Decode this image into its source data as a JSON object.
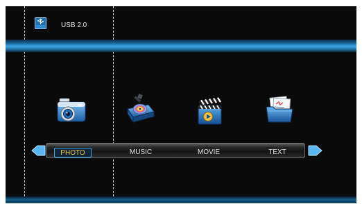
{
  "header": {
    "device_label": "USB 2.0",
    "device_icon": "usb-drive-icon"
  },
  "menu": {
    "items": [
      {
        "label": "PHOTO",
        "icon": "camera-icon",
        "selected": true
      },
      {
        "label": "MUSIC",
        "icon": "music-projector-icon",
        "selected": false
      },
      {
        "label": "MOVIE",
        "icon": "clapperboard-icon",
        "selected": false
      },
      {
        "label": "TEXT",
        "icon": "document-icon",
        "selected": false
      }
    ],
    "left_arrow": "arrow-left-icon",
    "right_arrow": "arrow-right-icon"
  },
  "colors": {
    "accent": "#3ea6e3",
    "selected_text": "#f0c232",
    "background": "#0a0a0a"
  }
}
